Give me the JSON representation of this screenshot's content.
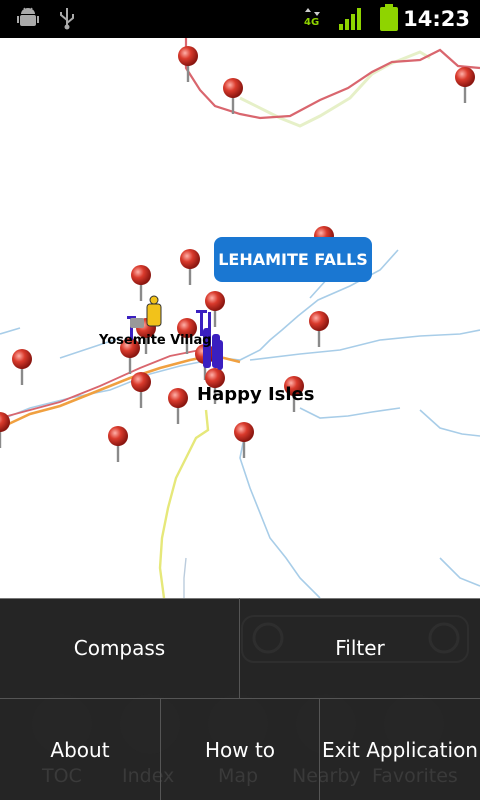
{
  "status_bar": {
    "time": "14:23",
    "network": "4G",
    "icons": [
      "android-debug-icon",
      "usb-icon",
      "network-4g-icon",
      "signal-icon",
      "battery-icon"
    ]
  },
  "map": {
    "callout": "LEHAMITE FALLS",
    "labels": {
      "yosemite_village": "Yosemite Village",
      "happy_isles": "Happy Isles"
    }
  },
  "menu": {
    "compass": "Compass",
    "filter": "Filter",
    "about": "About",
    "how_to": "How to",
    "exit": "Exit Application"
  },
  "background_toolbar": {
    "toc": "TOC",
    "index": "Index",
    "map": "Map",
    "nearby": "Nearby",
    "favorites": "Favorites"
  },
  "colors": {
    "pin_red": "#c8261d",
    "road_orange": "#f0a040",
    "road_red": "#d9666e",
    "callout_blue": "#1a77d2",
    "poi_purple": "#3a1fc0"
  }
}
